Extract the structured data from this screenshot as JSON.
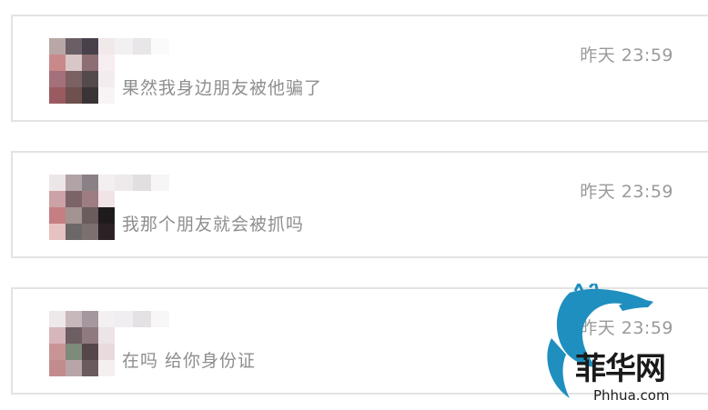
{
  "chats": [
    {
      "time": "昨天 23:59",
      "message": "果然我身边朋友被他骗了"
    },
    {
      "time": "昨天 23:59",
      "message": "我那个朋友就会被抓吗"
    },
    {
      "time": "昨天 23:59",
      "message": "在吗 给你身份证"
    }
  ],
  "watermark": {
    "brand": "菲华网",
    "url": "Phhua.com"
  },
  "colors": {
    "border": "#e3e3e3",
    "text_muted": "#8e8e8e",
    "dragon": "#1e8fbf"
  }
}
